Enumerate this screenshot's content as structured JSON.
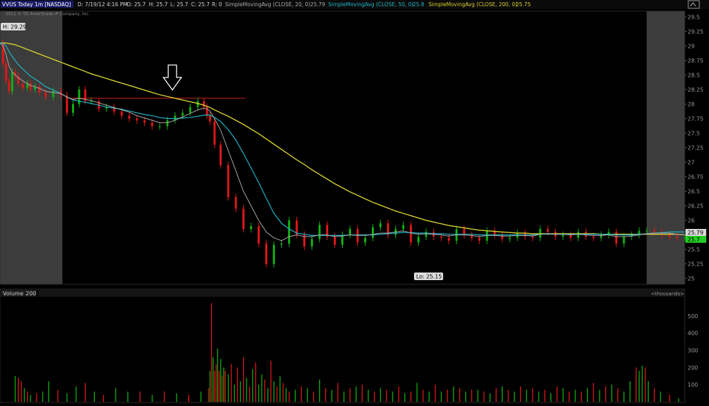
{
  "header": {
    "symbol": "VVUS Today 1m [NASDAQ]",
    "date": "D: 7/19/12 4:16 PM",
    "open": "O: 25.7",
    "high": "H: 25.7",
    "low": "L: 25.7",
    "close": "C: 25.7",
    "range": "R: 0",
    "sma1_name": "SimpleMovingAvg (CLOSE, 20, 0)",
    "sma1_value": "25.79",
    "sma2_name": "SimpleMovingAvg (CLOSE, 50, 0)",
    "sma2_value": "25.8",
    "sma3_name": "SimpleMovingAvg (CLOSE, 200, 0)",
    "sma3_value": "25.75",
    "copyright": "2012 © TD Ameritrade IP Company, Inc."
  },
  "labels": {
    "high_label": "H: 29.29",
    "low_label": "Lo: 25.15",
    "last_sma": "25.79",
    "last_price": "25.7"
  },
  "volume_panel": {
    "title": "Volume",
    "period": "200",
    "units": "<thousands>"
  },
  "colors": {
    "up": "#10b010",
    "down": "#e01818",
    "sma20": "#a8a8a8",
    "sma50": "#1fb5c8",
    "sma200": "#d8d030",
    "extended_hours_bg": "#404040",
    "support_line": "#d02020"
  },
  "chart_data": [
    {
      "type": "line",
      "title": "VVUS Today 1m [NASDAQ]",
      "xlabel": "",
      "ylabel": "",
      "ylim": [
        24.9,
        29.6
      ],
      "y_ticks": [
        "29.5",
        "29.25",
        "29",
        "28.75",
        "28.5",
        "28.25",
        "28",
        "27.75",
        "27.5",
        "27.25",
        "27",
        "26.75",
        "26.5",
        "26.25",
        "26",
        "25.75",
        "25.5",
        "25.25",
        "25"
      ],
      "x": [
        0,
        2,
        4,
        6,
        8,
        10,
        12,
        15,
        18,
        20,
        23,
        26,
        30,
        35,
        40,
        44,
        48,
        52,
        56,
        60,
        65,
        70,
        75,
        80,
        85,
        90,
        95,
        100,
        105,
        110,
        115,
        120,
        125,
        130,
        134,
        136,
        138,
        141,
        145,
        150,
        155,
        160,
        165,
        170,
        175,
        180,
        185,
        190,
        195,
        200,
        205,
        210,
        215,
        220,
        225,
        230,
        235,
        240,
        245,
        250,
        255,
        260,
        265,
        270,
        275,
        280,
        285,
        290,
        295,
        300,
        305,
        310,
        315,
        320,
        325,
        330,
        335,
        340,
        345,
        350,
        355,
        360,
        365,
        370,
        375,
        380,
        385,
        390,
        395,
        400,
        405,
        410,
        415,
        420,
        425,
        430,
        435,
        440,
        445,
        450
      ],
      "series": [
        {
          "name": "",
          "values": [
            29.05,
            28.7,
            28.4,
            28.22,
            28.55,
            28.48,
            28.35,
            28.28,
            28.36,
            28.25,
            28.3,
            28.2,
            28.12,
            28.22,
            28.15,
            27.85,
            28.0,
            28.25,
            28.05,
            28.05,
            27.92,
            27.95,
            27.87,
            27.8,
            27.75,
            27.72,
            27.68,
            27.62,
            27.62,
            27.72,
            27.8,
            27.85,
            27.95,
            28.05,
            27.95,
            27.8,
            27.7,
            27.3,
            26.95,
            26.4,
            26.2,
            25.85,
            25.9,
            25.6,
            25.25,
            25.58,
            25.6,
            26.0,
            25.75,
            25.55,
            25.68,
            25.92,
            25.72,
            25.58,
            25.75,
            25.85,
            25.62,
            25.7,
            25.88,
            25.95,
            25.75,
            25.85,
            25.92,
            25.62,
            25.72,
            25.8,
            25.72,
            25.7,
            25.65,
            25.85,
            25.75,
            25.7,
            25.65,
            25.82,
            25.75,
            25.68,
            25.7,
            25.78,
            25.72,
            25.7,
            25.85,
            25.8,
            25.72,
            25.75,
            25.7,
            25.8,
            25.72,
            25.7,
            25.75,
            25.8,
            25.6,
            25.72,
            25.75,
            25.82,
            25.82,
            25.8,
            25.75,
            25.72,
            25.7,
            25.7
          ]
        },
        {
          "name": "SimpleMovingAvg (CLOSE, 20, 0)",
          "values": [
            29.05,
            29.0,
            28.85,
            28.65,
            28.55,
            28.5,
            28.45,
            28.4,
            28.35,
            28.32,
            28.3,
            28.27,
            28.22,
            28.2,
            28.18,
            28.12,
            28.08,
            28.1,
            28.08,
            28.06,
            28.02,
            27.98,
            27.94,
            27.9,
            27.86,
            27.8,
            27.76,
            27.72,
            27.68,
            27.68,
            27.72,
            27.78,
            27.84,
            27.9,
            27.93,
            27.92,
            27.88,
            27.75,
            27.55,
            27.2,
            26.85,
            26.5,
            26.25,
            26.0,
            25.8,
            25.7,
            25.65,
            25.72,
            25.75,
            25.72,
            25.72,
            25.75,
            25.75,
            25.72,
            25.73,
            25.75,
            25.74,
            25.74,
            25.76,
            25.78,
            25.78,
            25.8,
            25.82,
            25.78,
            25.76,
            25.77,
            25.76,
            25.75,
            25.73,
            25.75,
            25.75,
            25.74,
            25.72,
            25.74,
            25.74,
            25.73,
            25.73,
            25.74,
            25.74,
            25.73,
            25.76,
            25.77,
            25.76,
            25.76,
            25.75,
            25.76,
            25.75,
            25.74,
            25.74,
            25.75,
            25.72,
            25.72,
            25.73,
            25.75,
            25.77,
            25.78,
            25.78,
            25.78,
            25.76,
            25.75
          ]
        },
        {
          "name": "SimpleMovingAvg (CLOSE, 50, 0)",
          "values": [
            29.05,
            29.04,
            29.0,
            28.9,
            28.82,
            28.75,
            28.68,
            28.6,
            28.53,
            28.48,
            28.43,
            28.38,
            28.3,
            28.24,
            28.18,
            28.12,
            28.07,
            28.05,
            28.03,
            28.01,
            27.98,
            27.95,
            27.93,
            27.91,
            27.88,
            27.85,
            27.82,
            27.8,
            27.77,
            27.75,
            27.75,
            27.76,
            27.77,
            27.79,
            27.81,
            27.81,
            27.81,
            27.77,
            27.7,
            27.56,
            27.38,
            27.15,
            26.9,
            26.65,
            26.38,
            26.12,
            25.95,
            25.85,
            25.78,
            25.76,
            25.74,
            25.74,
            25.74,
            25.74,
            25.74,
            25.75,
            25.75,
            25.75,
            25.75,
            25.76,
            25.77,
            25.78,
            25.79,
            25.79,
            25.78,
            25.78,
            25.77,
            25.77,
            25.76,
            25.76,
            25.76,
            25.76,
            25.75,
            25.75,
            25.75,
            25.75,
            25.75,
            25.75,
            25.75,
            25.75,
            25.76,
            25.76,
            25.76,
            25.76,
            25.76,
            25.76,
            25.76,
            25.76,
            25.76,
            25.76,
            25.75,
            25.75,
            25.75,
            25.76,
            25.77,
            25.78,
            25.79,
            25.8,
            25.8,
            25.8
          ]
        },
        {
          "name": "SimpleMovingAvg (CLOSE, 200, 0)",
          "values": [
            29.05,
            29.05,
            29.05,
            29.04,
            29.03,
            29.02,
            29.0,
            28.97,
            28.94,
            28.92,
            28.89,
            28.86,
            28.82,
            28.77,
            28.72,
            28.68,
            28.64,
            28.6,
            28.56,
            28.52,
            28.48,
            28.44,
            28.4,
            28.36,
            28.32,
            28.28,
            28.24,
            28.2,
            28.16,
            28.13,
            28.1,
            28.07,
            28.04,
            28.01,
            27.98,
            27.96,
            27.94,
            27.9,
            27.85,
            27.79,
            27.72,
            27.65,
            27.57,
            27.49,
            27.4,
            27.31,
            27.22,
            27.13,
            27.04,
            26.96,
            26.87,
            26.79,
            26.71,
            26.63,
            26.56,
            26.49,
            26.43,
            26.37,
            26.31,
            26.26,
            26.21,
            26.16,
            26.12,
            26.08,
            26.04,
            26.0,
            25.97,
            25.94,
            25.91,
            25.89,
            25.87,
            25.85,
            25.83,
            25.82,
            25.81,
            25.8,
            25.79,
            25.78,
            25.78,
            25.77,
            25.77,
            25.77,
            25.77,
            25.77,
            25.77,
            25.77,
            25.77,
            25.77,
            25.76,
            25.76,
            25.76,
            25.76,
            25.76,
            25.76,
            25.76,
            25.76,
            25.76,
            25.76,
            25.76,
            25.75
          ]
        }
      ],
      "annotations": [
        "H: 29.29",
        "Lo: 25.15",
        "25.79",
        "25.7"
      ]
    },
    {
      "type": "bar",
      "title": "Volume",
      "ylabel": "<thousands>",
      "ylim": [
        0,
        600
      ],
      "y_ticks": [
        "500",
        "400",
        "300",
        "200",
        "100"
      ],
      "x": [
        10,
        12,
        14,
        16,
        18,
        20,
        24,
        28,
        32,
        38,
        44,
        50,
        56,
        62,
        68,
        76,
        84,
        92,
        100,
        108,
        116,
        124,
        132,
        137,
        138,
        139,
        140,
        141,
        142,
        143,
        144,
        145,
        146,
        147,
        148,
        150,
        152,
        154,
        156,
        158,
        160,
        162,
        164,
        166,
        168,
        170,
        172,
        174,
        176,
        178,
        180,
        182,
        184,
        186,
        188,
        190,
        194,
        198,
        202,
        206,
        210,
        214,
        218,
        222,
        226,
        230,
        234,
        238,
        242,
        246,
        250,
        254,
        258,
        262,
        266,
        270,
        274,
        278,
        282,
        286,
        290,
        294,
        298,
        302,
        306,
        310,
        314,
        318,
        322,
        326,
        330,
        334,
        338,
        342,
        346,
        350,
        354,
        358,
        362,
        366,
        370,
        374,
        378,
        382,
        386,
        390,
        394,
        398,
        402,
        406,
        410,
        414,
        418,
        420,
        422,
        424,
        426,
        430,
        434,
        440,
        446
      ],
      "values": [
        150,
        140,
        120,
        80,
        60,
        40,
        50,
        60,
        120,
        70,
        50,
        90,
        110,
        60,
        40,
        80,
        60,
        60,
        40,
        60,
        50,
        40,
        60,
        80,
        180,
        575,
        260,
        180,
        220,
        310,
        180,
        250,
        150,
        200,
        180,
        160,
        220,
        100,
        200,
        120,
        260,
        140,
        90,
        190,
        230,
        100,
        160,
        130,
        80,
        240,
        120,
        90,
        150,
        110,
        80,
        60,
        70,
        90,
        80,
        60,
        130,
        80,
        70,
        110,
        60,
        80,
        90,
        100,
        70,
        60,
        80,
        70,
        60,
        90,
        50,
        60,
        110,
        70,
        60,
        100,
        60,
        70,
        90,
        80,
        60,
        70,
        70,
        60,
        50,
        80,
        90,
        70,
        60,
        90,
        70,
        80,
        60,
        70,
        50,
        90,
        80,
        60,
        70,
        60,
        80,
        110,
        70,
        90,
        100,
        80,
        60,
        120,
        200,
        180,
        210,
        200,
        120,
        80,
        60,
        40,
        20
      ],
      "colors": [
        "up",
        "down",
        "down",
        "up",
        "down",
        "up",
        "down",
        "up",
        "up",
        "down",
        "up",
        "up",
        "down",
        "up",
        "down",
        "up",
        "up",
        "down",
        "up",
        "down",
        "up",
        "down",
        "up",
        "down",
        "up",
        "down",
        "up",
        "down",
        "down",
        "up",
        "down",
        "up",
        "down",
        "up",
        "down",
        "up",
        "down",
        "up",
        "down",
        "up",
        "down",
        "up",
        "down",
        "up",
        "down",
        "up",
        "up",
        "down",
        "up",
        "down",
        "up",
        "down",
        "up",
        "down",
        "up",
        "down",
        "up",
        "down",
        "up",
        "down",
        "up",
        "down",
        "up",
        "down",
        "up",
        "down",
        "up",
        "down",
        "up",
        "down",
        "up",
        "down",
        "up",
        "down",
        "up",
        "down",
        "up",
        "down",
        "up",
        "down",
        "up",
        "down",
        "up",
        "down",
        "up",
        "down",
        "up",
        "down",
        "up",
        "down",
        "up",
        "down",
        "up",
        "down",
        "up",
        "down",
        "up",
        "down",
        "up",
        "down",
        "up",
        "down",
        "up",
        "down",
        "up",
        "down",
        "up",
        "down",
        "up",
        "down",
        "up",
        "up",
        "down",
        "up",
        "up",
        "down",
        "up",
        "down",
        "up",
        "down"
      ]
    }
  ]
}
